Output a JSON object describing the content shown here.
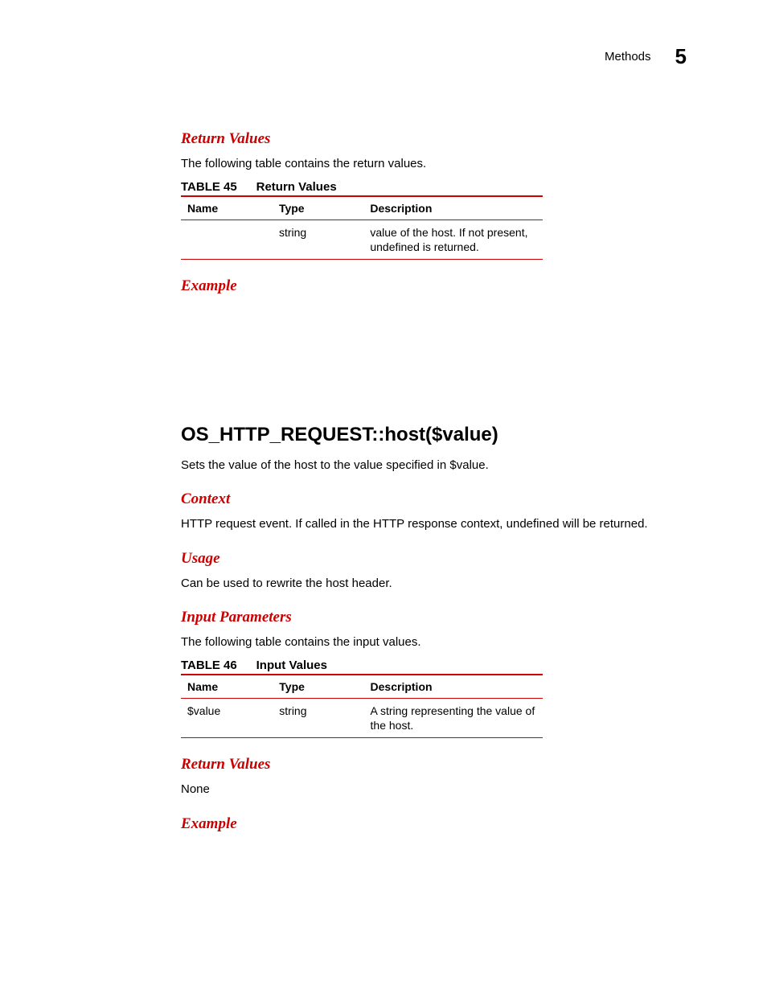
{
  "header": {
    "section": "Methods",
    "chapter": "5"
  },
  "sec1": {
    "heading": "Return Values",
    "intro": "The following table contains the return values.",
    "table_num": "TABLE 45",
    "table_title": "Return Values",
    "cols": {
      "name": "Name",
      "type": "Type",
      "desc": "Description"
    },
    "row": {
      "name": "",
      "type": "string",
      "desc": "value of the host. If not present, undefined is returned."
    }
  },
  "sec2": {
    "heading": "Example"
  },
  "method": {
    "title": "OS_HTTP_REQUEST::host($value)",
    "desc": "Sets the value of the host to the value specified in $value."
  },
  "context": {
    "heading": "Context",
    "body": "HTTP request event. If called in the HTTP response context, undefined will be returned."
  },
  "usage": {
    "heading": "Usage",
    "body": "Can be used to rewrite the host header."
  },
  "input": {
    "heading": "Input Parameters",
    "intro": "The following table contains the input values.",
    "table_num": "TABLE 46",
    "table_title": "Input Values",
    "cols": {
      "name": "Name",
      "type": "Type",
      "desc": "Description"
    },
    "row": {
      "name": "$value",
      "type": "string",
      "desc": "A string representing the value of the host."
    }
  },
  "retvals2": {
    "heading": "Return Values",
    "body": "None"
  },
  "example2": {
    "heading": "Example"
  }
}
